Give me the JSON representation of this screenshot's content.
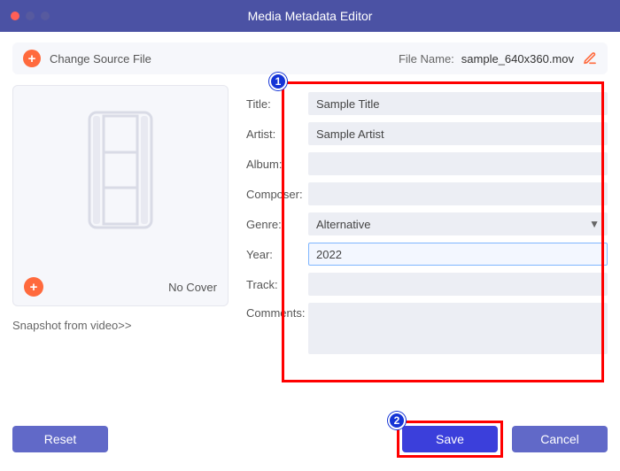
{
  "window": {
    "title": "Media Metadata Editor"
  },
  "toprow": {
    "change_source_label": "Change Source File",
    "filename_label": "File Name:",
    "filename_value": "sample_640x360.mov"
  },
  "cover": {
    "no_cover_label": "No Cover",
    "snapshot_link": "Snapshot from video>>"
  },
  "form": {
    "title_label": "Title:",
    "title_value": "Sample Title",
    "artist_label": "Artist:",
    "artist_value": "Sample Artist",
    "album_label": "Album:",
    "album_value": "",
    "composer_label": "Composer:",
    "composer_value": "",
    "genre_label": "Genre:",
    "genre_value": "Alternative",
    "year_label": "Year:",
    "year_value": "2022",
    "track_label": "Track:",
    "track_value": "",
    "comments_label": "Comments:",
    "comments_value": ""
  },
  "buttons": {
    "reset": "Reset",
    "save": "Save",
    "cancel": "Cancel"
  },
  "annotations": {
    "one": "1",
    "two": "2"
  }
}
